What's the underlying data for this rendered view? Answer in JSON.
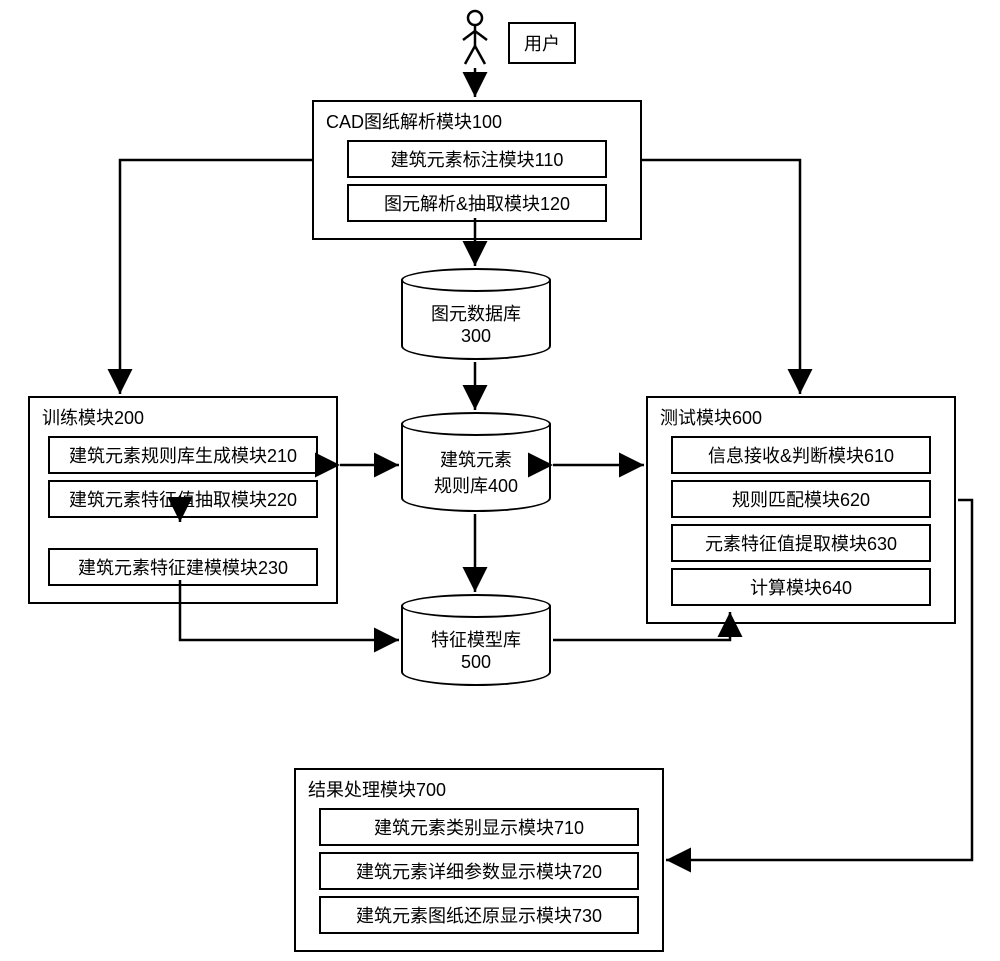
{
  "chart_data": {
    "type": "flowchart",
    "nodes": [
      {
        "id": "user",
        "label": "用户",
        "type": "actor"
      },
      {
        "id": "100",
        "label": "CAD图纸解析模块100",
        "type": "module",
        "children": [
          {
            "id": "110",
            "label": "建筑元素标注模块110"
          },
          {
            "id": "120",
            "label": "图元解析&抽取模块120"
          }
        ]
      },
      {
        "id": "300",
        "label": "图元数据库",
        "sub": "300",
        "type": "datastore"
      },
      {
        "id": "200",
        "label": "训练模块200",
        "type": "module",
        "children": [
          {
            "id": "210",
            "label": "建筑元素规则库生成模块210"
          },
          {
            "id": "220",
            "label": "建筑元素特征值抽取模块220"
          },
          {
            "id": "230",
            "label": "建筑元素特征建模模块230"
          }
        ]
      },
      {
        "id": "400",
        "label": "建筑元素",
        "sub": "规则库400",
        "type": "datastore"
      },
      {
        "id": "600",
        "label": "测试模块600",
        "type": "module",
        "children": [
          {
            "id": "610",
            "label": "信息接收&判断模块610"
          },
          {
            "id": "620",
            "label": "规则匹配模块620"
          },
          {
            "id": "630",
            "label": "元素特征值提取模块630"
          },
          {
            "id": "640",
            "label": "计算模块640"
          }
        ]
      },
      {
        "id": "500",
        "label": "特征模型库",
        "sub": "500",
        "type": "datastore"
      },
      {
        "id": "700",
        "label": "结果处理模块700",
        "type": "module",
        "children": [
          {
            "id": "710",
            "label": "建筑元素类别显示模块710"
          },
          {
            "id": "720",
            "label": "建筑元素详细参数显示模块720"
          },
          {
            "id": "730",
            "label": "建筑元素图纸还原显示模块730"
          }
        ]
      }
    ],
    "edges": [
      {
        "from": "user",
        "to": "100",
        "dir": "one"
      },
      {
        "from": "100",
        "to": "300",
        "dir": "one"
      },
      {
        "from": "100",
        "to": "200",
        "dir": "one"
      },
      {
        "from": "100",
        "to": "600",
        "dir": "one"
      },
      {
        "from": "300",
        "to": "400",
        "dir": "one"
      },
      {
        "from": "200",
        "to": "400",
        "dir": "two"
      },
      {
        "from": "400",
        "to": "600",
        "dir": "two"
      },
      {
        "from": "400",
        "to": "500",
        "dir": "one"
      },
      {
        "from": "200",
        "to": "500",
        "dir": "one"
      },
      {
        "from": "500",
        "to": "600",
        "dir": "one"
      },
      {
        "from": "600",
        "to": "700",
        "dir": "one"
      },
      {
        "from": "220",
        "to": "230",
        "dir": "one"
      }
    ]
  },
  "user_label": "用户",
  "mod100": {
    "title": "CAD图纸解析模块100",
    "s110": "建筑元素标注模块110",
    "s120": "图元解析&抽取模块120"
  },
  "db300": {
    "l1": "图元数据库",
    "l2": "300"
  },
  "mod200": {
    "title": "训练模块200",
    "s210": "建筑元素规则库生成模块210",
    "s220": "建筑元素特征值抽取模块220",
    "s230": "建筑元素特征建模模块230"
  },
  "db400": {
    "l1": "建筑元素",
    "l2": "规则库400"
  },
  "mod600": {
    "title": "测试模块600",
    "s610": "信息接收&判断模块610",
    "s620": "规则匹配模块620",
    "s630": "元素特征值提取模块630",
    "s640": "计算模块640"
  },
  "db500": {
    "l1": "特征模型库",
    "l2": "500"
  },
  "mod700": {
    "title": "结果处理模块700",
    "s710": "建筑元素类别显示模块710",
    "s720": "建筑元素详细参数显示模块720",
    "s730": "建筑元素图纸还原显示模块730"
  }
}
